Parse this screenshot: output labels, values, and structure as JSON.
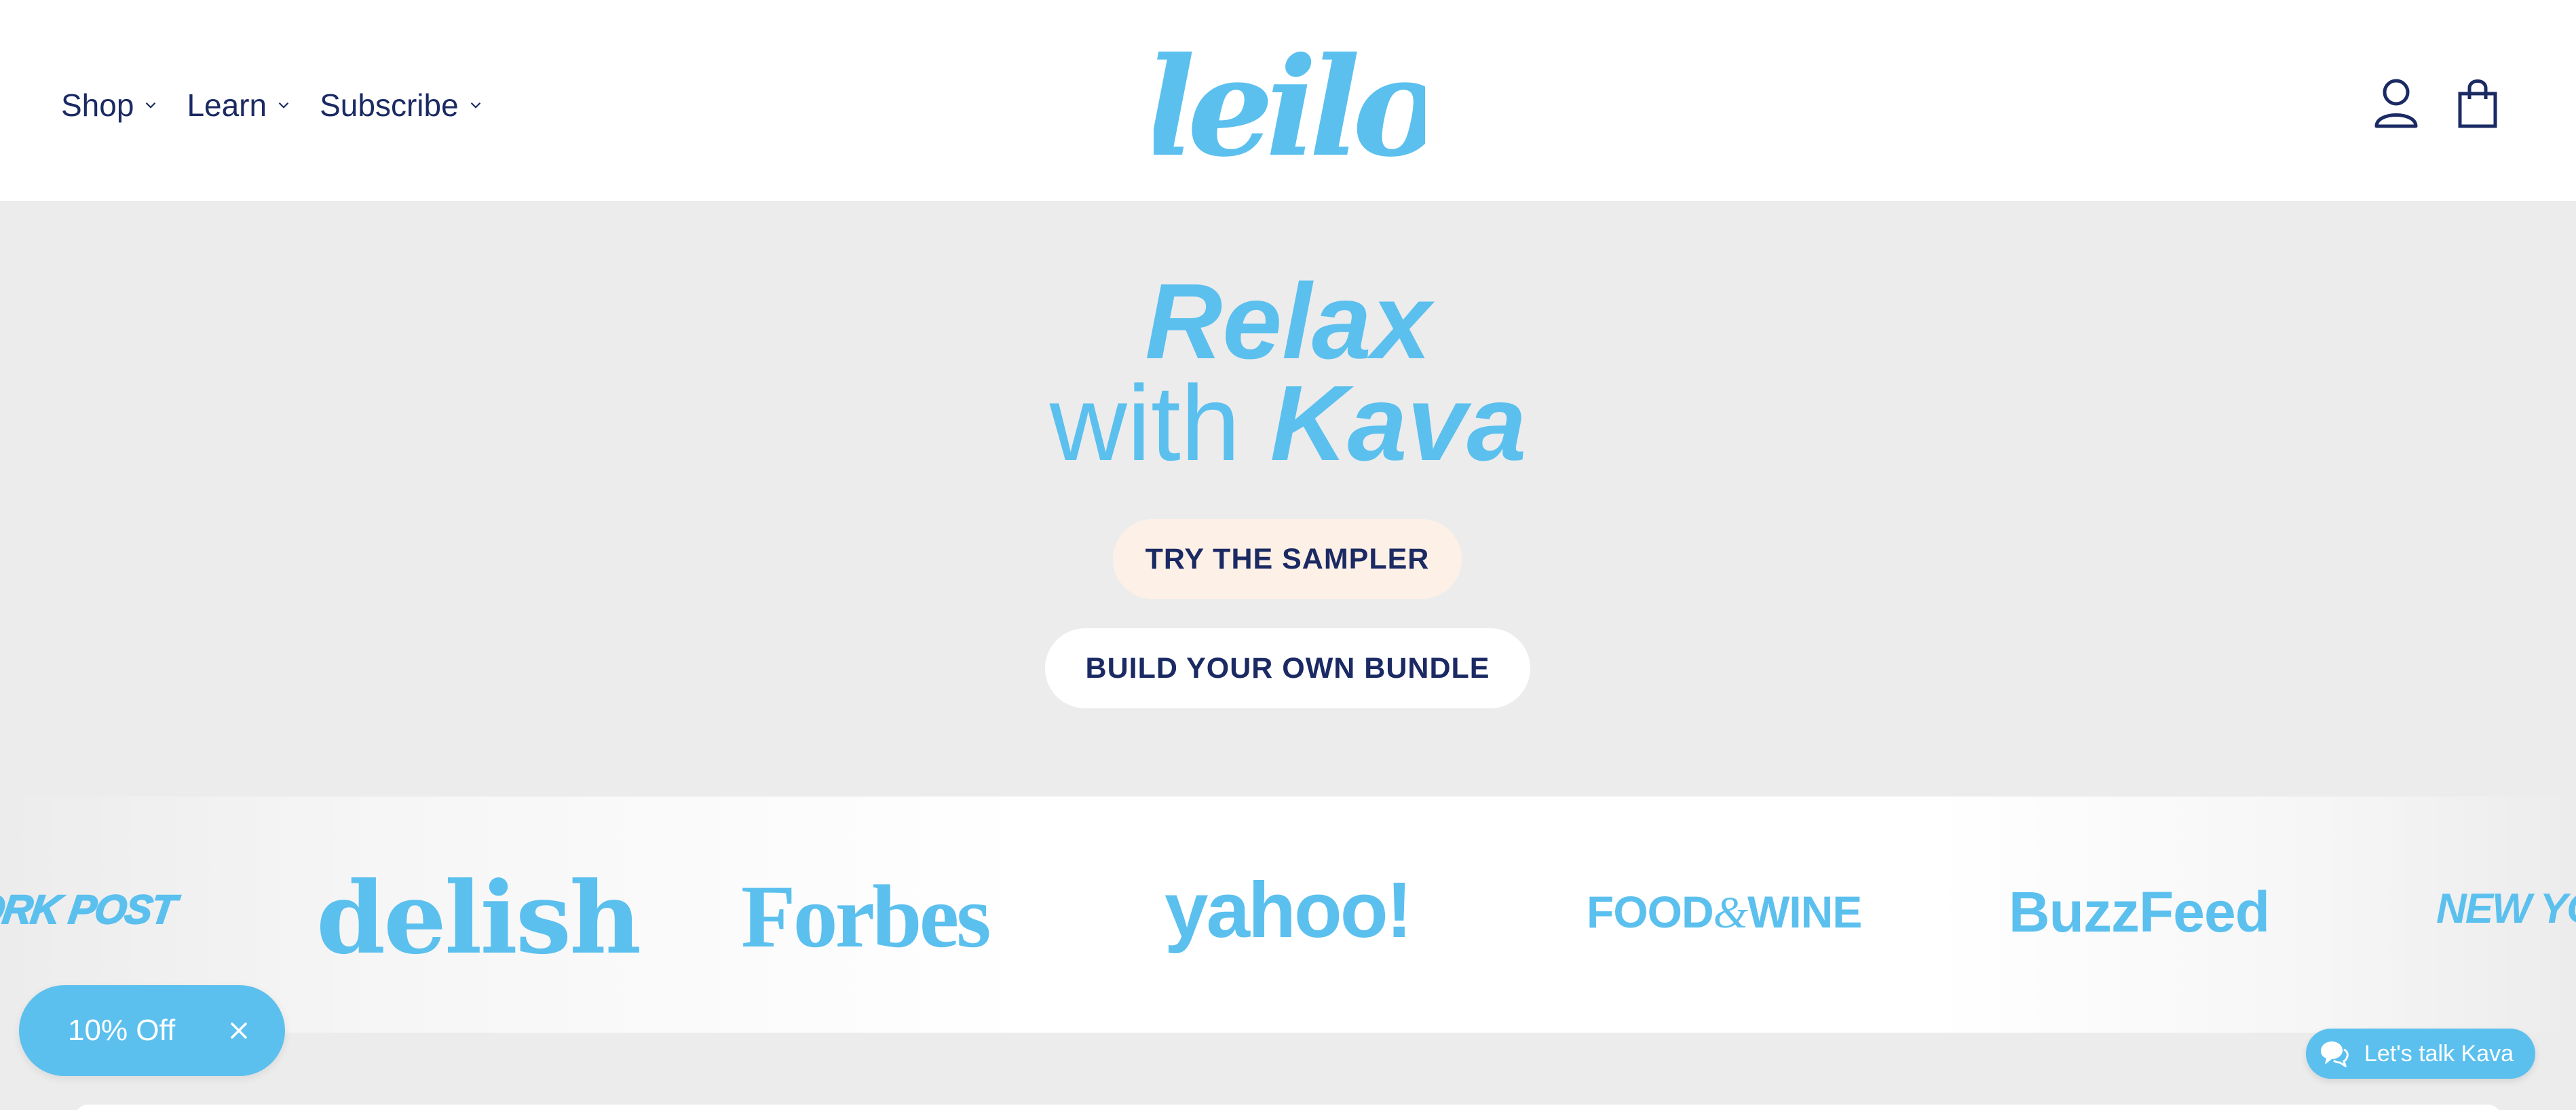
{
  "header": {
    "nav": [
      {
        "label": "Shop"
      },
      {
        "label": "Learn"
      },
      {
        "label": "Subscribe"
      }
    ],
    "logo_text": "leilo",
    "icons": [
      "account-icon",
      "cart-icon"
    ]
  },
  "hero": {
    "line1": "Relax",
    "line2_regular": "with",
    "line2_bold": "Kava",
    "primary_button": "TRY THE SAMPLER",
    "secondary_button": "BUILD YOUR OWN BUNDLE"
  },
  "press": {
    "logos": [
      "NEW YORK POST",
      "delish",
      "Forbes",
      "yahoo!",
      "FOOD&WINE",
      "BuzzFeed",
      "NEW YORK"
    ]
  },
  "press_display": {
    "nypost": "ORK POST",
    "delish": "delish",
    "forbes": "Forbes",
    "yahoo": "yahoo!",
    "food": "FOOD",
    "food_amp": "&",
    "wine": "WINE",
    "buzzfeed": "BuzzFeed",
    "newyork": "NEW YOR"
  },
  "discount": {
    "label": "10% Off"
  },
  "chat": {
    "label": "Let's talk Kava"
  },
  "colors": {
    "brand_blue": "#5bc0ee",
    "navy": "#1b2a63",
    "background": "#ececec",
    "sampler_bg": "#fdf0e6"
  }
}
